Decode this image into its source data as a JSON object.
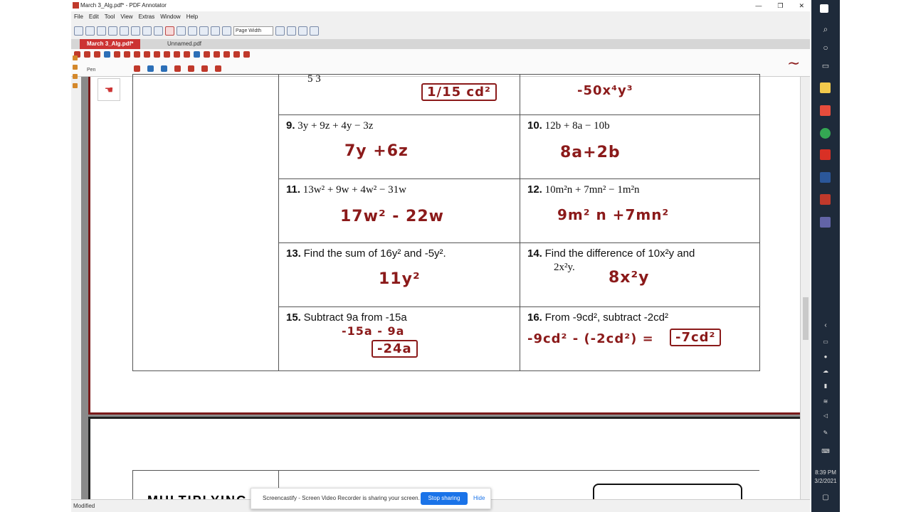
{
  "window": {
    "title": "March 3_Alg.pdf* - PDF Annotator"
  },
  "menu": [
    "File",
    "Edit",
    "Tool",
    "View",
    "Extras",
    "Window",
    "Help"
  ],
  "toolbar": {
    "zoom_value": "Page Width"
  },
  "tabs": [
    {
      "label": "March 3_Alg.pdf*"
    },
    {
      "label": "Unnamed.pdf"
    }
  ],
  "ribbon": {
    "tool_label": "Pen"
  },
  "worksheet": {
    "top_left_partial": "5        3",
    "top_answer_left": "1/15 cd²",
    "top_answer_right": "-50x⁴y³",
    "problems": [
      {
        "num": "9.",
        "expr": "3y + 9z + 4y − 3z",
        "answer": "7y +6z"
      },
      {
        "num": "10.",
        "expr": "12b + 8a − 10b",
        "answer": "8a+2b"
      },
      {
        "num": "11.",
        "expr": "13w² + 9w + 4w² − 31w",
        "answer": "17w² - 22w"
      },
      {
        "num": "12.",
        "expr": "10m²n + 7mn² − 1m²n",
        "answer": "9m² n +7mn²"
      },
      {
        "num": "13.",
        "expr_text": "Find the sum of 16y² and -5y².",
        "answer": "11y²"
      },
      {
        "num": "14.",
        "expr_text_1": "Find the difference of 10x²y and",
        "expr_text_2": "2x²y.",
        "answer": "8x²y"
      },
      {
        "num": "15.",
        "expr_text": "Subtract 9a from -15a",
        "work": "-15a - 9a",
        "answer": "-24a"
      },
      {
        "num": "16.",
        "expr_text": "From -9cd², subtract -2cd²",
        "work": "-9cd² - (-2cd²) =",
        "answer": "-7cd²"
      }
    ],
    "page2_partial": "MULTIPLYING"
  },
  "status": {
    "text": "Modified"
  },
  "screencast": {
    "message": "Screencastify - Screen Video Recorder is sharing your screen.",
    "stop_label": "Stop sharing",
    "hide_label": "Hide"
  },
  "tray": {
    "time": "8:39 PM",
    "date": "3/2/2021"
  },
  "colors": {
    "ink": "#8b1a1a",
    "accent": "#cc3333",
    "taskbar": "#1e2a3a"
  }
}
